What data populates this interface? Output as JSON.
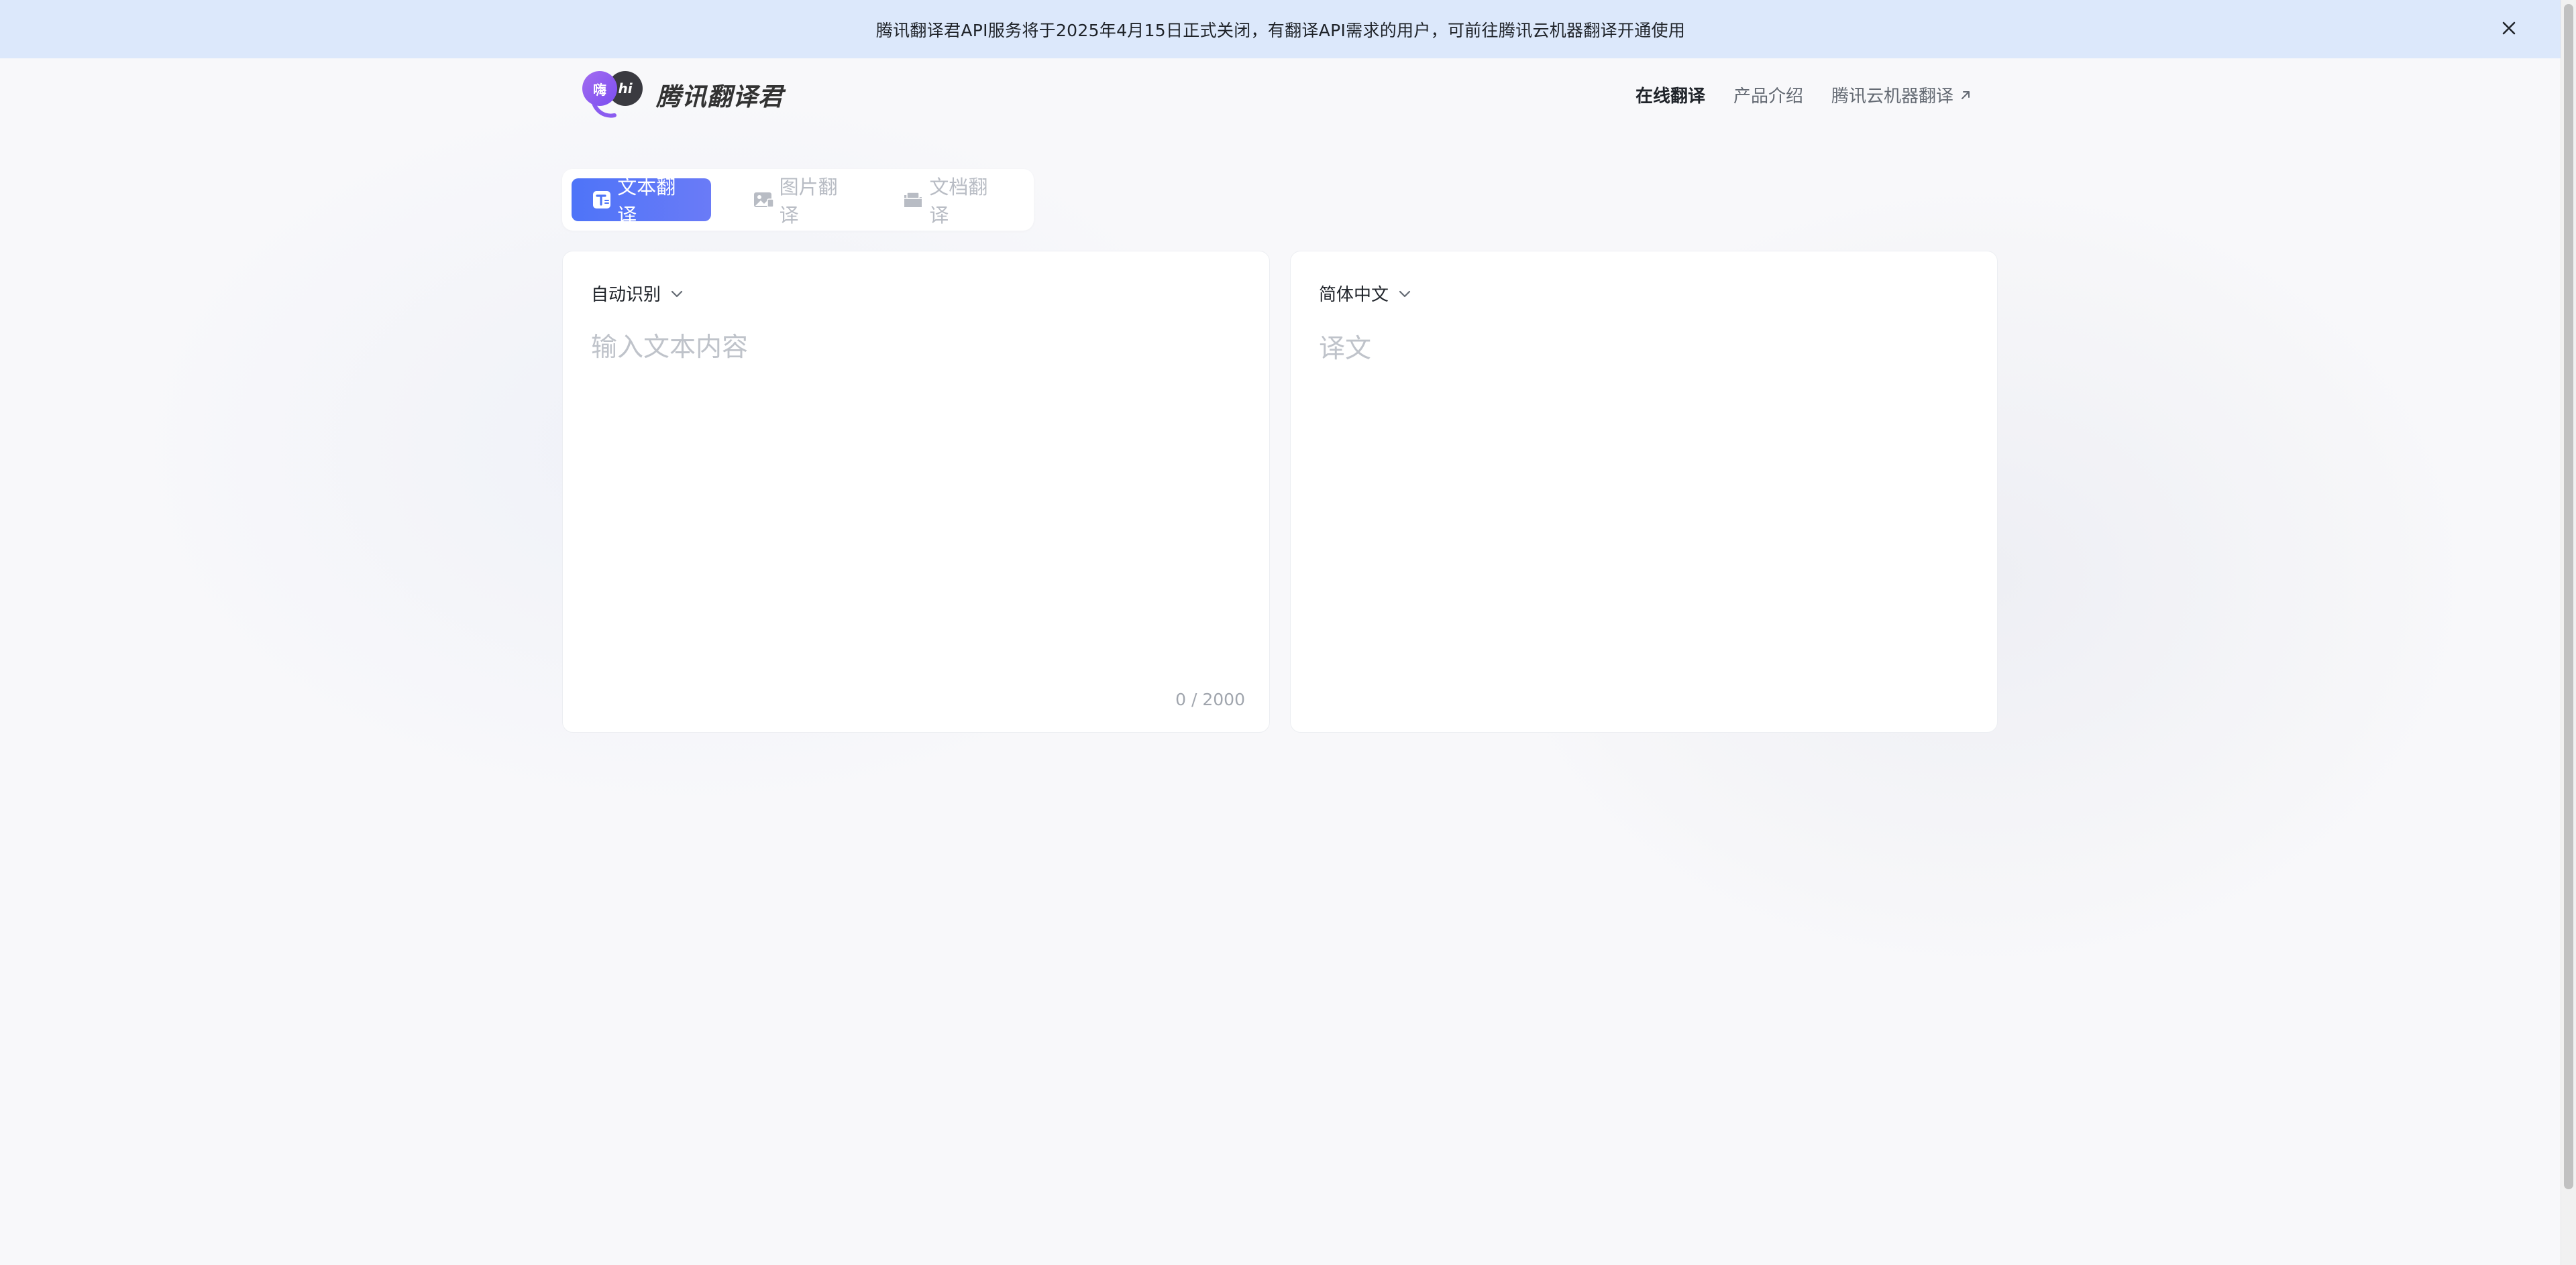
{
  "banner": {
    "text": "腾讯翻译君API服务将于2025年4月15日正式关闭，有翻译API需求的用户，可前往腾讯云机器翻译开通使用",
    "close_icon": "close-icon"
  },
  "brand": {
    "bubble_a": "嗨",
    "bubble_b": "hi",
    "name": "腾讯翻译君"
  },
  "nav": {
    "items": [
      {
        "label": "在线翻译"
      },
      {
        "label": "产品介绍"
      },
      {
        "label": "腾讯云机器翻译"
      }
    ],
    "active_index": 0
  },
  "tabs": {
    "items": [
      {
        "label": "文本翻译",
        "icon": "text-translate-icon"
      },
      {
        "label": "图片翻译",
        "icon": "image-translate-icon"
      },
      {
        "label": "文档翻译",
        "icon": "document-translate-icon"
      }
    ],
    "active_index": 0
  },
  "source": {
    "language": "自动识别",
    "placeholder": "输入文本内容",
    "value": "",
    "char_count": "0 / 2000"
  },
  "target": {
    "language": "简体中文",
    "placeholder": "译文"
  },
  "colors": {
    "banner_bg": "#dce8fb",
    "accent": "#4e74f8",
    "brand_purple": "#8b5cf0"
  }
}
